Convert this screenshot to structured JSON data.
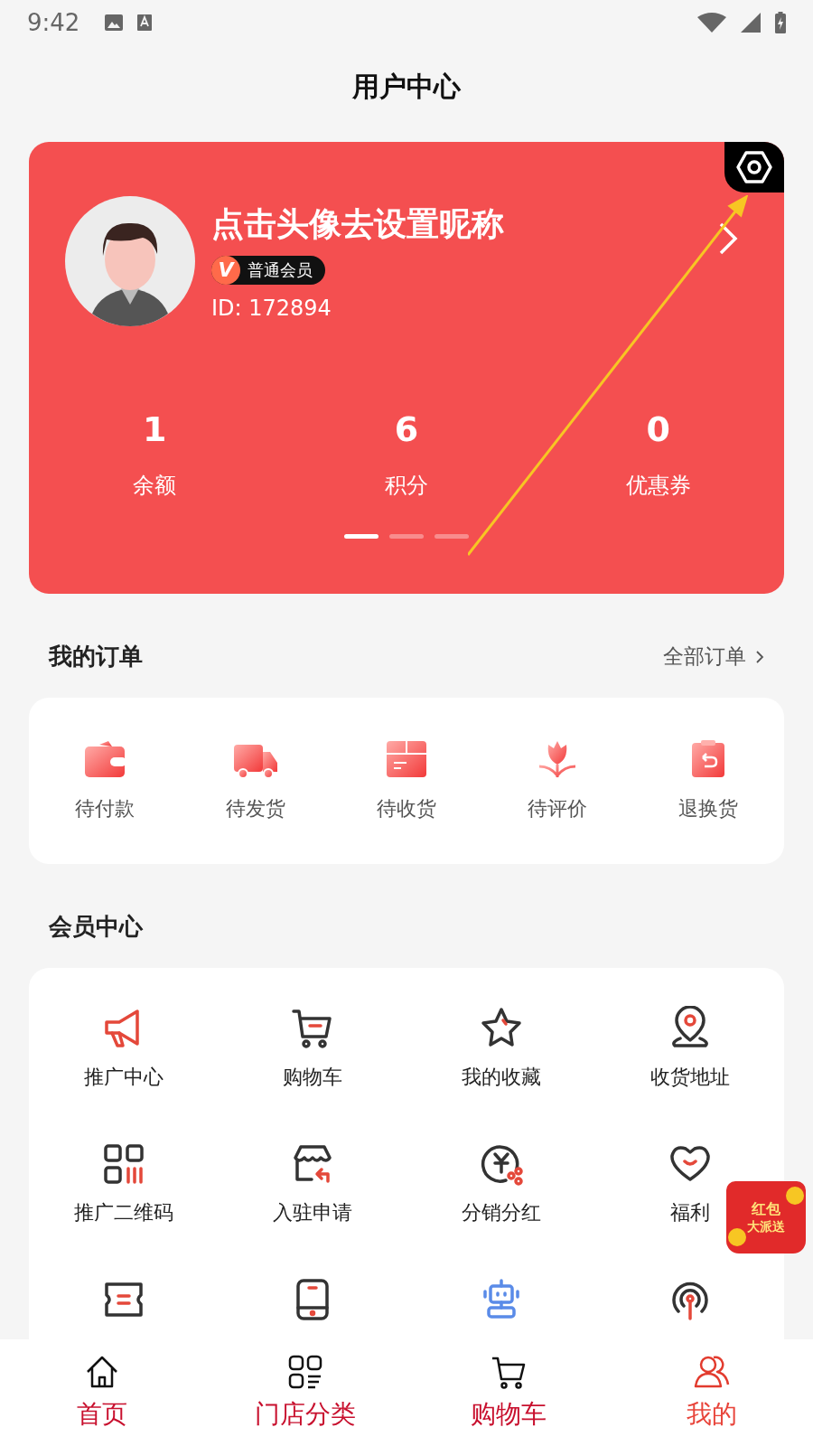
{
  "status_bar": {
    "time": "9:42"
  },
  "header": {
    "title": "用户中心"
  },
  "profile": {
    "nickname": "点击头像去设置昵称",
    "badge_mark": "V",
    "member_level": "普通会员",
    "id_text": "ID: 172894",
    "stats": [
      {
        "value": "1",
        "label": "余额"
      },
      {
        "value": "6",
        "label": "积分"
      },
      {
        "value": "0",
        "label": "优惠券"
      }
    ],
    "pages": [
      {
        "selected": true
      },
      {
        "selected": false
      },
      {
        "selected": false
      }
    ]
  },
  "orders": {
    "title": "我的订单",
    "link": "全部订单",
    "items": [
      {
        "label": "待付款"
      },
      {
        "label": "待发货"
      },
      {
        "label": "待收货"
      },
      {
        "label": "待评价"
      },
      {
        "label": "退换货"
      }
    ]
  },
  "member_center": {
    "title": "会员中心",
    "items": [
      {
        "label": "推广中心"
      },
      {
        "label": "购物车"
      },
      {
        "label": "我的收藏"
      },
      {
        "label": "收货地址"
      },
      {
        "label": "推广二维码"
      },
      {
        "label": "入驻申请"
      },
      {
        "label": "分销分红"
      },
      {
        "label": "福利"
      }
    ]
  },
  "envelope_badge": {
    "line1": "红包",
    "line2": "大派送"
  },
  "tab_bar": [
    {
      "label": "首页",
      "selected": false
    },
    {
      "label": "门店分类",
      "selected": false
    },
    {
      "label": "购物车",
      "selected": false
    },
    {
      "label": "我的",
      "selected": true
    }
  ]
}
